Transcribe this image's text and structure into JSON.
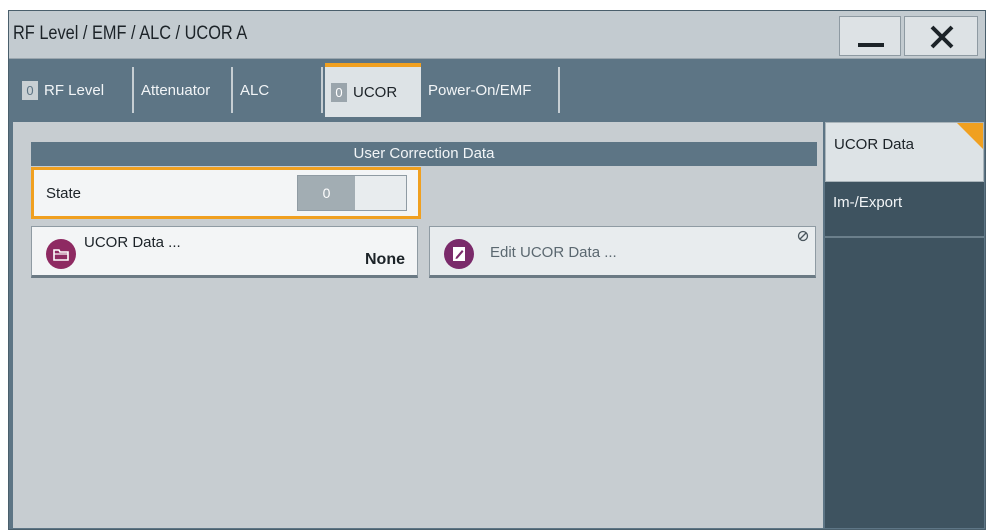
{
  "window": {
    "title": "RF Level / EMF / ALC / UCOR A",
    "minimize_icon": "minimize-icon",
    "close_icon": "close-icon"
  },
  "tabs": [
    {
      "label": "RF Level",
      "state": "0",
      "active": false
    },
    {
      "label": "Attenuator",
      "active": false
    },
    {
      "label": "ALC",
      "active": false
    },
    {
      "label": "UCOR",
      "state": "0",
      "active": true
    },
    {
      "label": "Power-On/EMF",
      "active": false
    }
  ],
  "section": {
    "header": "User Correction Data"
  },
  "state_field": {
    "label": "State",
    "value": "0"
  },
  "ucor_data_button": {
    "label": "UCOR Data ...",
    "value": "None",
    "icon": "folder-icon"
  },
  "edit_button": {
    "label": "Edit UCOR Data ...",
    "icon": "edit-document-icon",
    "corner_icon": "disabled-icon"
  },
  "side_panel": {
    "items": [
      {
        "label": "UCOR Data",
        "active": true
      },
      {
        "label": "Im-/Export",
        "active": false
      }
    ]
  },
  "colors": {
    "accent": "#f0a020",
    "panel": "#5d7585",
    "icon_bg": "#8e2a62"
  }
}
